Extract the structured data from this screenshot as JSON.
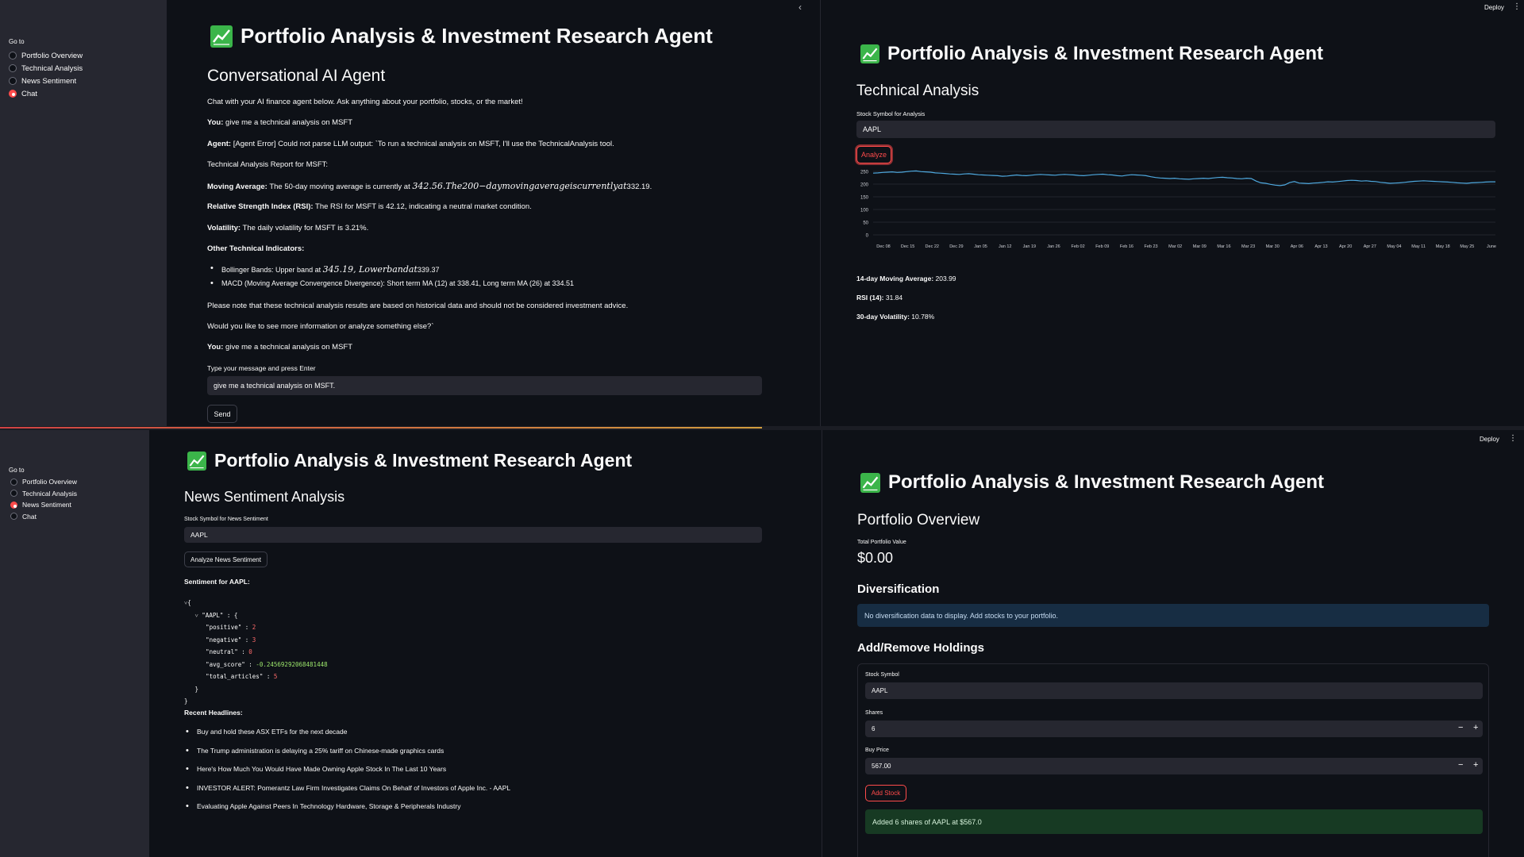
{
  "app": {
    "title": "Portfolio Analysis & Investment Research Agent",
    "deploy_label": "Deploy",
    "menu_glyph": "⋮",
    "collapse_glyph": "‹"
  },
  "sidebar": {
    "goto_label": "Go to",
    "items": [
      "Portfolio Overview",
      "Technical Analysis",
      "News Sentiment",
      "Chat"
    ]
  },
  "chat_page": {
    "heading": "Conversational AI Agent",
    "intro": "Chat with your AI finance agent below. Ask anything about your portfolio, stocks, or the market!",
    "you_label": "You:",
    "agent_label": "Agent:",
    "msg1": "give me a technical analysis on MSFT",
    "agent_msg": "[Agent Error] Could not parse LLM output: `To run a technical analysis on MSFT, I'll use the TechnicalAnalysis tool.",
    "report_title": "Technical Analysis Report for MSFT:",
    "ma_label": "Moving Average:",
    "ma_text_a": "The 50-day moving average is currently at",
    "ma_math": "342.56.The200−daymovingaverageiscurrentlyat",
    "ma_text_b": "332.19.",
    "rsi_label": "Relative Strength Index (RSI):",
    "rsi_text": "The RSI for MSFT is 42.12, indicating a neutral market condition.",
    "vol_label": "Volatility:",
    "vol_text": "The daily volatility for MSFT is 3.21%.",
    "other_label": "Other Technical Indicators:",
    "bb_text_a": "Bollinger Bands: Upper band at",
    "bb_math": "345.19, Lowerbandat",
    "bb_text_b": "339.37",
    "macd_text": "MACD (Moving Average Convergence Divergence): Short term MA (12) at 338.41, Long term MA (26) at 334.51",
    "disclaimer": "Please note that these technical analysis results are based on historical data and should not be considered investment advice.",
    "followup": "Would you like to see more information or analyze something else?`",
    "msg2": "give me a technical analysis on MSFT",
    "input_label": "Type your message and press Enter",
    "input_value": "give me a technical analysis on MSFT.",
    "send_label": "Send"
  },
  "tech_page": {
    "heading": "Technical Analysis",
    "symbol_label": "Stock Symbol for Analysis",
    "symbol_value": "AAPL",
    "analyze_label": "Analyze",
    "ma_label": "14-day Moving Average:",
    "ma_value": "203.99",
    "rsi_label": "RSI (14):",
    "rsi_value": "31.84",
    "vol_label": "30-day Volatility:",
    "vol_value": "10.78%"
  },
  "news_page": {
    "heading": "News Sentiment Analysis",
    "symbol_label": "Stock Symbol for News Sentiment",
    "symbol_value": "AAPL",
    "analyze_label": "Analyze News Sentiment",
    "sentiment_label": "Sentiment for AAPL:",
    "json": {
      "ticker": "\"AAPL\"",
      "positive": "2",
      "negative": "3",
      "neutral": "0",
      "avg_score": "-0.24569292068481448",
      "total_articles": "5"
    },
    "headlines_label": "Recent Headlines:",
    "headlines": [
      "Buy and hold these ASX ETFs for the next decade",
      "The Trump administration is delaying a 25% tariff on Chinese-made graphics cards",
      "Here's How Much You Would Have Made Owning Apple Stock In The Last 10 Years",
      "INVESTOR ALERT: Pomerantz Law Firm Investigates Claims On Behalf of Investors of Apple Inc. - AAPL",
      "Evaluating Apple Against Peers In Technology Hardware, Storage & Peripherals Industry"
    ]
  },
  "portfolio_page": {
    "heading": "Portfolio Overview",
    "total_label": "Total Portfolio Value",
    "total_value": "$0.00",
    "div_heading": "Diversification",
    "div_info": "No diversification data to display. Add stocks to your portfolio.",
    "add_heading": "Add/Remove Holdings",
    "symbol_label": "Stock Symbol",
    "symbol_value": "AAPL",
    "shares_label": "Shares",
    "shares_value": "6",
    "price_label": "Buy Price",
    "price_value": "567.00",
    "minus": "−",
    "plus": "+",
    "add_label": "Add Stock",
    "success": "Added 6 shares of AAPL at $567.0"
  },
  "chart_data": {
    "type": "line",
    "title": "",
    "xlabel": "",
    "ylabel": "",
    "ylim": [
      0,
      250
    ],
    "yticks": [
      0,
      50,
      100,
      150,
      200,
      250
    ],
    "xticks": [
      "Dec 08",
      "Dec 15",
      "Dec 22",
      "Dec 29",
      "Jan 05",
      "Jan 12",
      "Jan 19",
      "Jan 26",
      "Feb 02",
      "Feb 09",
      "Feb 16",
      "Feb 23",
      "Mar 02",
      "Mar 09",
      "Mar 16",
      "Mar 23",
      "Mar 30",
      "Apr 06",
      "Apr 13",
      "Apr 20",
      "Apr 27",
      "May 04",
      "May 11",
      "May 18",
      "May 25",
      "June"
    ],
    "color": "#4ea8de",
    "series": [
      {
        "values": [
          243,
          244,
          246,
          247,
          248,
          246,
          247,
          249,
          251,
          252,
          249,
          248,
          247,
          244,
          243,
          242,
          240,
          239,
          238,
          240,
          241,
          239,
          237,
          236,
          235,
          234,
          233,
          231,
          232,
          234,
          236,
          234,
          233,
          235,
          237,
          238,
          237,
          236,
          235,
          237,
          238,
          237,
          236,
          234,
          233,
          235,
          237,
          238,
          239,
          237,
          236,
          233,
          232,
          235,
          237,
          236,
          235,
          233,
          229,
          226,
          224,
          223,
          222,
          223,
          221,
          220,
          219,
          221,
          222,
          223,
          222,
          224,
          226,
          227,
          225,
          224,
          222,
          221,
          223,
          222,
          212,
          205,
          203,
          199,
          196,
          194,
          197,
          206,
          210,
          204,
          203,
          202,
          204,
          205,
          207,
          209,
          208,
          210,
          212,
          214,
          215,
          214,
          212,
          213,
          211,
          210,
          207,
          205,
          203,
          204,
          205,
          207,
          209,
          211,
          212,
          213,
          212,
          211,
          210,
          209,
          208,
          207,
          205,
          204,
          203,
          205,
          206,
          207,
          208,
          209,
          209
        ]
      }
    ]
  }
}
